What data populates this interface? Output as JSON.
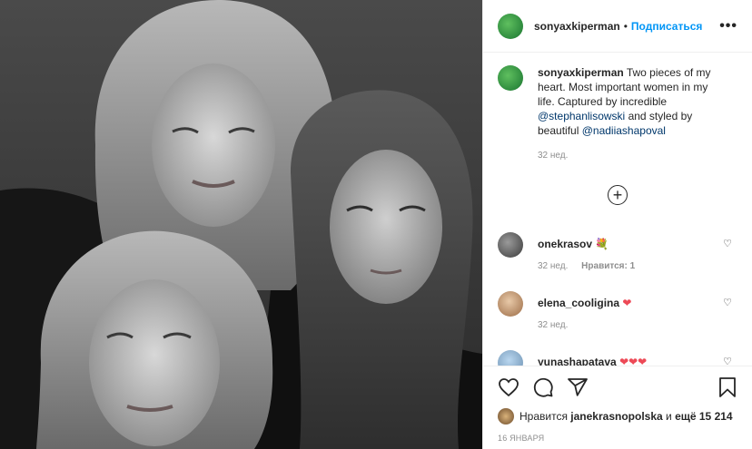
{
  "header": {
    "username": "sonyaxkiperman",
    "separator": "•",
    "follow_label": "Подписаться",
    "more_label": "•••"
  },
  "caption": {
    "username": "sonyaxkiperman",
    "text_1": "Two pieces of my heart. Most important women in my life. Captured by incredible",
    "mention_1": "@stephanlisowski",
    "text_2": "and styled by beautiful",
    "mention_2": "@nadiiashapoval",
    "timestamp": "32 нед."
  },
  "load_more_symbol": "+",
  "comments": [
    {
      "username": "onekrasov",
      "emoji": "💐",
      "timestamp": "32 нед.",
      "likes": "Нравится: 1"
    },
    {
      "username": "elena_cooligina",
      "emoji": "❤",
      "timestamp": "32 нед.",
      "likes": ""
    },
    {
      "username": "yunashapatava",
      "emoji": "❤❤❤",
      "timestamp": "",
      "likes": ""
    }
  ],
  "likes": {
    "prefix": "Нравится",
    "user": "janekrasnopolska",
    "middle": "и",
    "others": "ещё 15 214"
  },
  "date": "16 ЯНВАРЯ",
  "colors": {
    "accent": "#0095f6",
    "mention": "#00376b",
    "heart_red": "#ed4956",
    "muted": "#8e8e8e"
  },
  "icons": [
    "heart-icon",
    "comment-icon",
    "share-icon",
    "bookmark-icon",
    "plus-circle-icon",
    "more-icon"
  ]
}
